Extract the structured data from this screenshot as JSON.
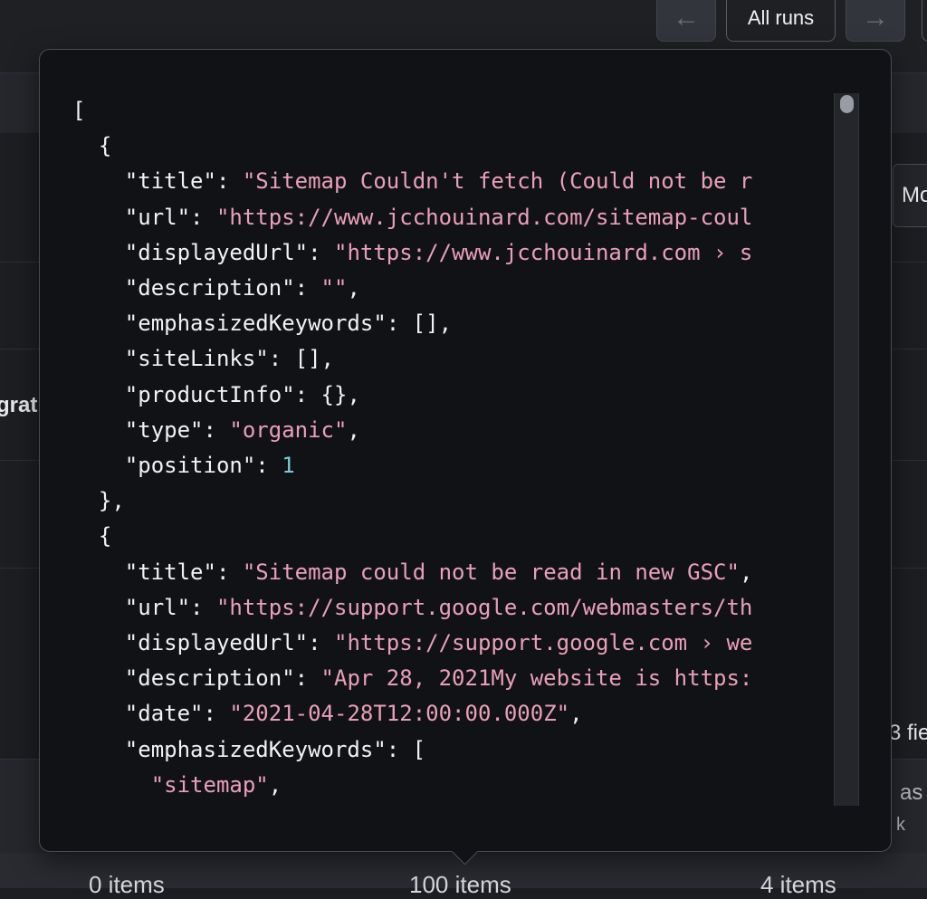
{
  "toolbar": {
    "prev_icon": "arrow-left-icon",
    "prev_glyph": "←",
    "all_runs_label": "All runs",
    "next_icon": "arrow-right-icon",
    "next_glyph": "→"
  },
  "background": {
    "left_partial_text": "grat",
    "right_partial_button": "Mo",
    "right_partial_fields": "3 fie",
    "right_partial_line1": "as",
    "right_partial_line2": "k",
    "counts": [
      "0 items",
      "100 items",
      "4 items"
    ]
  },
  "tooltip": {
    "json_lines": [
      [
        [
          "p",
          "["
        ]
      ],
      [
        [
          "p",
          "  {"
        ]
      ],
      [
        [
          "k",
          "    \"title\""
        ],
        [
          "p",
          ": "
        ],
        [
          "s",
          "\"Sitemap Couldn't fetch (Could not be r"
        ]
      ],
      [
        [
          "k",
          "    \"url\""
        ],
        [
          "p",
          ": "
        ],
        [
          "s",
          "\"https://www.jcchouinard.com/sitemap-coul"
        ]
      ],
      [
        [
          "k",
          "    \"displayedUrl\""
        ],
        [
          "p",
          ": "
        ],
        [
          "s",
          "\"https://www.jcchouinard.com › s"
        ]
      ],
      [
        [
          "k",
          "    \"description\""
        ],
        [
          "p",
          ": "
        ],
        [
          "s",
          "\"\""
        ],
        [
          "p",
          ","
        ]
      ],
      [
        [
          "k",
          "    \"emphasizedKeywords\""
        ],
        [
          "p",
          ": [],"
        ]
      ],
      [
        [
          "k",
          "    \"siteLinks\""
        ],
        [
          "p",
          ": [],"
        ]
      ],
      [
        [
          "k",
          "    \"productInfo\""
        ],
        [
          "p",
          ": {},"
        ]
      ],
      [
        [
          "k",
          "    \"type\""
        ],
        [
          "p",
          ": "
        ],
        [
          "s",
          "\"organic\""
        ],
        [
          "p",
          ","
        ]
      ],
      [
        [
          "k",
          "    \"position\""
        ],
        [
          "p",
          ": "
        ],
        [
          "n",
          "1"
        ]
      ],
      [
        [
          "p",
          "  },"
        ]
      ],
      [
        [
          "p",
          "  {"
        ]
      ],
      [
        [
          "k",
          "    \"title\""
        ],
        [
          "p",
          ": "
        ],
        [
          "s",
          "\"Sitemap could not be read in new GSC\""
        ],
        [
          "p",
          ","
        ]
      ],
      [
        [
          "k",
          "    \"url\""
        ],
        [
          "p",
          ": "
        ],
        [
          "s",
          "\"https://support.google.com/webmasters/th"
        ]
      ],
      [
        [
          "k",
          "    \"displayedUrl\""
        ],
        [
          "p",
          ": "
        ],
        [
          "s",
          "\"https://support.google.com › we"
        ]
      ],
      [
        [
          "k",
          "    \"description\""
        ],
        [
          "p",
          ": "
        ],
        [
          "s",
          "\"Apr 28, 2021My website is https:"
        ]
      ],
      [
        [
          "k",
          "    \"date\""
        ],
        [
          "p",
          ": "
        ],
        [
          "s",
          "\"2021-04-28T12:00:00.000Z\""
        ],
        [
          "p",
          ","
        ]
      ],
      [
        [
          "k",
          "    \"emphasizedKeywords\""
        ],
        [
          "p",
          ": ["
        ]
      ],
      [
        [
          "s",
          "      \"sitemap\""
        ],
        [
          "p",
          ","
        ]
      ]
    ]
  },
  "colors": {
    "key": "#f2f2f4",
    "string": "#e8a0b8",
    "number": "#78cdd8",
    "tooltip_bg": "#111215",
    "page_bg": "#1d1e22"
  }
}
